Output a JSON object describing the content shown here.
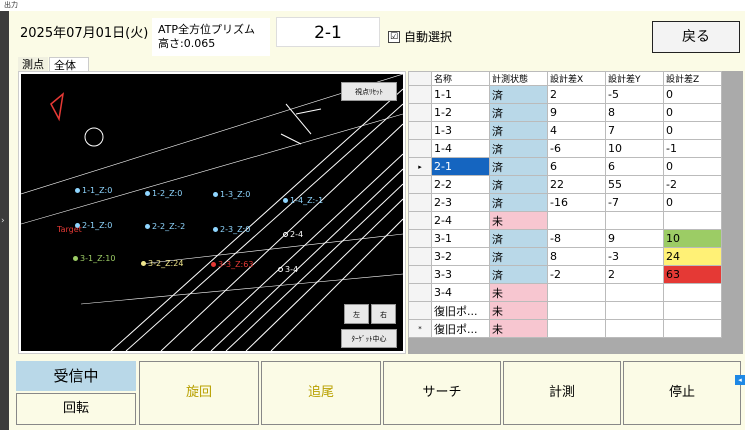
{
  "window": {
    "title": "出力"
  },
  "header": {
    "date": "2025年07月01日(火)",
    "prism_line1": "ATP全方位プリズム",
    "prism_line2": "高さ:0.065",
    "point_no": "2-1",
    "auto_select_label": "自動選択",
    "auto_select_checked": "☑",
    "back_label": "戻る"
  },
  "tabs": [
    {
      "label": "測点"
    },
    {
      "label": "全体"
    }
  ],
  "view": {
    "reset_label": "視点ﾘｾｯﾄ",
    "left_label": "左",
    "right_label": "右",
    "target_center_label": "ﾀｰｹﾞｯﾄ中心",
    "target_label": "Target",
    "point_labels": [
      {
        "id": "1-1",
        "text": "1-1_Z:0",
        "color": "#8fd6ff"
      },
      {
        "id": "1-2",
        "text": "1-2_Z:0",
        "color": "#8fd6ff"
      },
      {
        "id": "1-3",
        "text": "1-3_Z:0",
        "color": "#8fd6ff"
      },
      {
        "id": "1-4",
        "text": "1-4_Z:-1",
        "color": "#8fd6ff"
      },
      {
        "id": "2-1",
        "text": "2-1_Z:0",
        "color": "#8fd6ff"
      },
      {
        "id": "2-2",
        "text": "2-2_Z:-2",
        "color": "#8fd6ff"
      },
      {
        "id": "2-3",
        "text": "2-3_Z:0",
        "color": "#8fd6ff"
      },
      {
        "id": "2-4",
        "text": "2-4",
        "color": "#ffffff"
      },
      {
        "id": "3-1",
        "text": "3-1_Z:10",
        "color": "#9ccc65"
      },
      {
        "id": "3-2",
        "text": "3-2_Z:24",
        "color": "#f0e68c"
      },
      {
        "id": "3-3",
        "text": "3-3_Z:63",
        "color": "#e53935"
      },
      {
        "id": "3-4",
        "text": "3-4",
        "color": "#ffffff"
      }
    ]
  },
  "grid": {
    "columns": [
      "名称",
      "計測状態",
      "設計差X",
      "設計差Y",
      "設計差Z"
    ],
    "rows": [
      {
        "marker": "",
        "name": "1-1",
        "status": "済",
        "x": "2",
        "y": "-5",
        "z": "0",
        "z_color": ""
      },
      {
        "marker": "",
        "name": "1-2",
        "status": "済",
        "x": "9",
        "y": "8",
        "z": "0",
        "z_color": ""
      },
      {
        "marker": "",
        "name": "1-3",
        "status": "済",
        "x": "4",
        "y": "7",
        "z": "0",
        "z_color": ""
      },
      {
        "marker": "",
        "name": "1-4",
        "status": "済",
        "x": "-6",
        "y": "10",
        "z": "-1",
        "z_color": ""
      },
      {
        "marker": "▸",
        "name": "2-1",
        "status": "済",
        "x": "6",
        "y": "6",
        "z": "0",
        "z_color": ""
      },
      {
        "marker": "",
        "name": "2-2",
        "status": "済",
        "x": "22",
        "y": "55",
        "z": "-2",
        "z_color": ""
      },
      {
        "marker": "",
        "name": "2-3",
        "status": "済",
        "x": "-16",
        "y": "-7",
        "z": "0",
        "z_color": ""
      },
      {
        "marker": "",
        "name": "2-4",
        "status": "未",
        "x": "",
        "y": "",
        "z": "",
        "z_color": ""
      },
      {
        "marker": "",
        "name": "3-1",
        "status": "済",
        "x": "-8",
        "y": "9",
        "z": "10",
        "z_color": "#9ccc65"
      },
      {
        "marker": "",
        "name": "3-2",
        "status": "済",
        "x": "8",
        "y": "-3",
        "z": "24",
        "z_color": "#fff176"
      },
      {
        "marker": "",
        "name": "3-3",
        "status": "済",
        "x": "-2",
        "y": "2",
        "z": "63",
        "z_color": "#e53935"
      },
      {
        "marker": "",
        "name": "3-4",
        "status": "未",
        "x": "",
        "y": "",
        "z": "",
        "z_color": ""
      },
      {
        "marker": "",
        "name": "復旧ポ...",
        "status": "未",
        "x": "",
        "y": "",
        "z": "",
        "z_color": ""
      },
      {
        "marker": "*",
        "name": "復旧ポ...",
        "status": "未",
        "x": "",
        "y": "",
        "z": "",
        "z_color": ""
      }
    ],
    "status_colors": {
      "済": "#b9d8e8",
      "未": "#f7c6d0"
    },
    "selected_row": 4
  },
  "controls": {
    "receiving_label": "受信中",
    "rotate_label": "回転",
    "swivel_label": "旋回",
    "track_label": "追尾",
    "search_label": "サーチ",
    "measure_label": "計測",
    "stop_label": "停止",
    "disabled_text_color": "#b8a000"
  }
}
